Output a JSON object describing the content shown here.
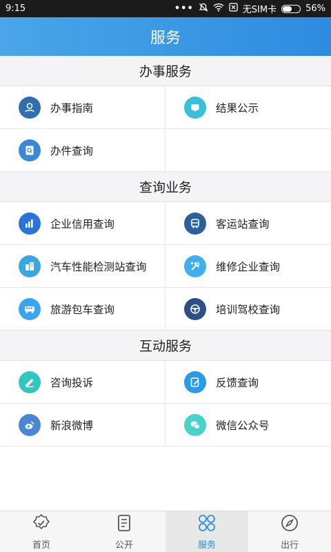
{
  "status_bar": {
    "time": "9:15",
    "dots": "•••",
    "carrier": "无SIM卡",
    "battery": "56%",
    "battery_level": 0.56
  },
  "header": {
    "title": "服务"
  },
  "sections": [
    {
      "title": "办事服务",
      "items": [
        {
          "label": "办事指南",
          "icon": "guide-icon",
          "color": "#2f6fb0"
        },
        {
          "label": "结果公示",
          "icon": "result-icon",
          "color": "#37c0d8"
        },
        {
          "label": "办件查询",
          "icon": "doc-search-icon",
          "color": "#3b88d4"
        }
      ]
    },
    {
      "title": "查询业务",
      "items": [
        {
          "label": "企业信用查询",
          "icon": "chart-icon",
          "color": "#2b74d6"
        },
        {
          "label": "客运站查询",
          "icon": "bus-icon",
          "color": "#2d5f9a"
        },
        {
          "label": "汽车性能检测站查询",
          "icon": "building-icon",
          "color": "#3aa6e2"
        },
        {
          "label": "维修企业查询",
          "icon": "tools-icon",
          "color": "#3fb0ec"
        },
        {
          "label": "旅游包车查询",
          "icon": "coach-icon",
          "color": "#3aa4ee"
        },
        {
          "label": "培训驾校查询",
          "icon": "steering-wheel-icon",
          "color": "#2c4f8a"
        }
      ]
    },
    {
      "title": "互动服务",
      "items": [
        {
          "label": "咨询投诉",
          "icon": "consult-icon",
          "color": "#2fc7c0"
        },
        {
          "label": "反馈查询",
          "icon": "feedback-icon",
          "color": "#2b9be8"
        },
        {
          "label": "新浪微博",
          "icon": "weibo-icon",
          "color": "#4a86d6"
        },
        {
          "label": "微信公众号",
          "icon": "wechat-icon",
          "color": "#48d3c8"
        }
      ]
    }
  ],
  "bottom_nav": [
    {
      "label": "首页",
      "icon": "home-badge-icon",
      "active": false
    },
    {
      "label": "公开",
      "icon": "document-icon",
      "active": false
    },
    {
      "label": "服务",
      "icon": "clover-icon",
      "active": true
    },
    {
      "label": "出行",
      "icon": "compass-icon",
      "active": false
    }
  ]
}
